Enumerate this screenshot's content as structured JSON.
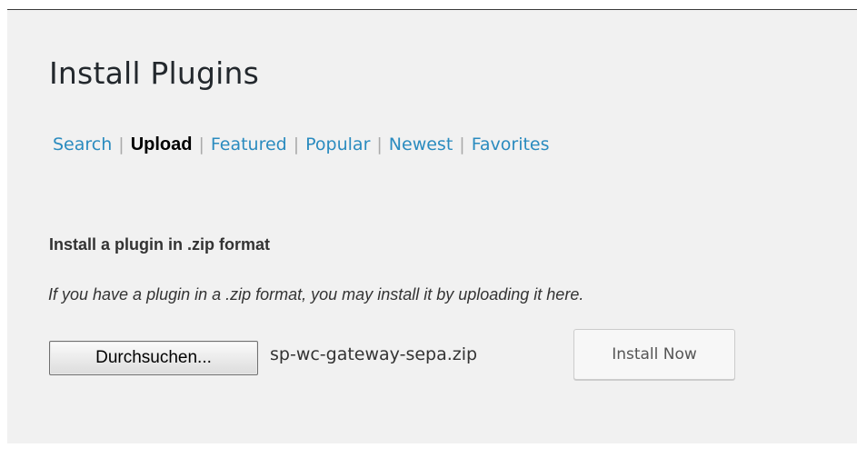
{
  "page": {
    "title": "Install Plugins"
  },
  "subnav": {
    "items": [
      {
        "label": "Search",
        "current": false
      },
      {
        "label": "Upload",
        "current": true
      },
      {
        "label": "Featured",
        "current": false
      },
      {
        "label": "Popular",
        "current": false
      },
      {
        "label": "Newest",
        "current": false
      },
      {
        "label": "Favorites",
        "current": false
      }
    ],
    "separator": "|"
  },
  "upload": {
    "heading": "Install a plugin in .zip format",
    "description": "If you have a plugin in a .zip format, you may install it by uploading it here.",
    "browse_label": "Durchsuchen...",
    "file_name": "sp-wc-gateway-sepa.zip",
    "install_label": "Install Now"
  },
  "colors": {
    "link": "#2a8bbf",
    "background": "#f1f1f1",
    "text": "#333333"
  }
}
